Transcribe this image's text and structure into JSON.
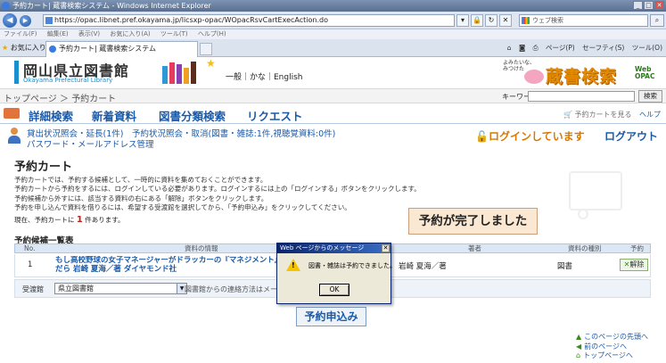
{
  "browser": {
    "window_title": "予約カート| 蔵書検索システム - Windows Internet Explorer",
    "url": "https://opac.libnet.pref.okayama.jp/licsxp-opac/WOpacRsvCartExecAction.do",
    "search_placeholder": "ウェブ検索",
    "menu": [
      "ファイル(F)",
      "編集(E)",
      "表示(V)",
      "お気に入り(A)",
      "ツール(T)",
      "ヘルプ(H)"
    ],
    "favorites_label": "お気に入り",
    "tab_title": "予約カート| 蔵書検索システム",
    "command_bar": [
      "ページ(P)",
      "セーフティ(S)",
      "ツール(O)"
    ]
  },
  "header": {
    "library_name": "岡山県立図書館",
    "library_name_en": "Okayama Prefectural Library",
    "language_links": "一般｜かな｜English",
    "mascot_caption": "よみたいな、\nみつけた",
    "service_title": "蔵書検索",
    "service_badge": "Web\nOPAC"
  },
  "breadcrumb": {
    "home": "トップページ",
    "separator": "＞",
    "current": "予約カート",
    "keyword_label": "キーワード",
    "search_button": "検索"
  },
  "nav": {
    "items": [
      "詳細検索",
      "新着資料",
      "図書分類検索",
      "リクエスト"
    ],
    "view_cart": "予約カートを見る",
    "help": "ヘルプ"
  },
  "user": {
    "line1": "貸出状況照会・延長(1件)　予約状況照会・取消(図書・雑誌:1件,視聴覚資料:0件)",
    "line2": "パスワード・メールアドレス管理",
    "login_status": "ログインしています",
    "logout": "ログアウト"
  },
  "content": {
    "title": "予約カート",
    "description": [
      "予約カートでは、予約する候補として、一時的に資料を集めておくことができます。",
      "予約カートから予約をするには、ログインしている必要があります。ログインするには上の「ログインする」ボタンをクリックします。",
      "予約候補から外すには、該当する資料の右にある「解除」ボタンをクリックします。",
      "予約を申し込んで資料を借りるには、希望する受渡館を選択してから、「予約申込み」をクリックしてください。"
    ],
    "count_prefix": "現在、予約カートに",
    "count_value": "1",
    "count_suffix": "件あります。",
    "completion_message": "予約が完了しました",
    "list_title": "予約候補一覧表",
    "table": {
      "headers": [
        "No.",
        "資料の情報",
        "著者",
        "資料の種別",
        "予約"
      ],
      "rows": [
        {
          "no": "1",
          "title_line1": "もし高校野球の女子マネージャーがドラッカーの『マネジメント』を",
          "title_line2": "だら  岩崎 夏海／著  ダイヤモンド社",
          "author": "岩崎 夏海／著",
          "type": "図書",
          "cancel_label": "解除"
        }
      ]
    },
    "pickup_label": "受渡館",
    "pickup_selected": "県立図書館",
    "pickup_note": "図書館からの連絡方法はメー",
    "submit_button": "予約申込み"
  },
  "dialog": {
    "title": "Web ページからのメッセージ",
    "message": "図書・雑誌は予約できました。",
    "ok": "OK"
  },
  "footer": {
    "links": [
      "このページの先頭へ",
      "前のページへ",
      "トップページへ"
    ]
  },
  "colors": {
    "accent_blue": "#1a5aa8",
    "login_orange": "#d97800",
    "banner_bg": "#fbe8d2",
    "count_red": "#d01818"
  }
}
